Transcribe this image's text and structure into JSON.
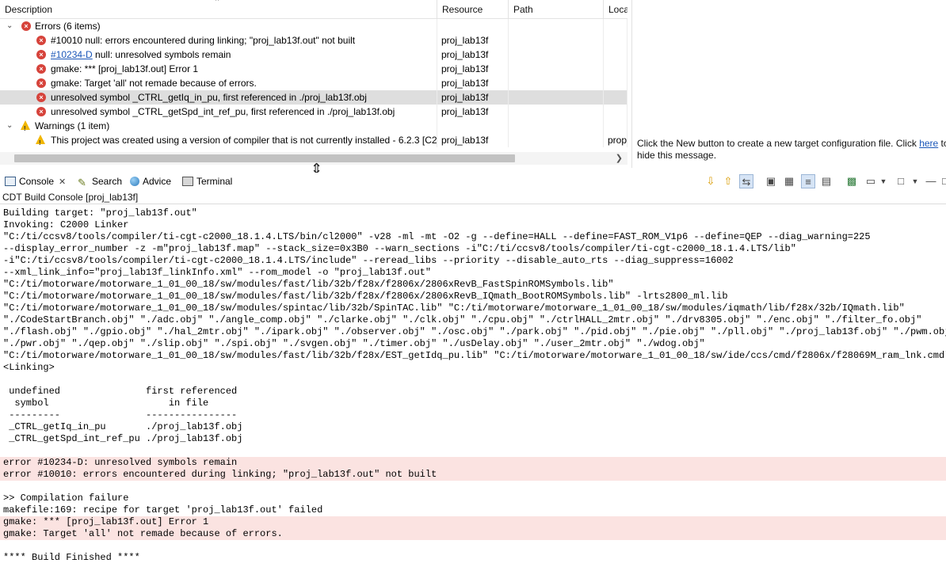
{
  "problems": {
    "columns": {
      "description": "Description",
      "resource": "Resource",
      "path": "Path",
      "location": "Loca"
    },
    "groups": [
      {
        "label": "Errors (6 items)",
        "kind": "error"
      },
      {
        "label": "Warnings (1 item)",
        "kind": "warning"
      }
    ],
    "errors": [
      {
        "link": "",
        "text": "#10010 null: errors encountered during linking; \"proj_lab13f.out\" not built",
        "resource": "proj_lab13f",
        "path": "",
        "location": ""
      },
      {
        "link": "#10234-D",
        "text": " null: unresolved symbols remain",
        "resource": "proj_lab13f",
        "path": "",
        "location": ""
      },
      {
        "link": "",
        "text": "gmake: *** [proj_lab13f.out] Error 1",
        "resource": "proj_lab13f",
        "path": "",
        "location": ""
      },
      {
        "link": "",
        "text": "gmake: Target 'all' not remade because of errors.",
        "resource": "proj_lab13f",
        "path": "",
        "location": ""
      },
      {
        "link": "",
        "text": "unresolved symbol _CTRL_getIq_in_pu, first referenced in ./proj_lab13f.obj",
        "resource": "proj_lab13f",
        "path": "",
        "location": ""
      },
      {
        "link": "",
        "text": "unresolved symbol _CTRL_getSpd_int_ref_pu, first referenced in ./proj_lab13f.obj",
        "resource": "proj_lab13f",
        "path": "",
        "location": ""
      }
    ],
    "warnings": [
      {
        "text": "This project was created using a version of compiler that is not currently installed - 6.2.3 [C20",
        "resource": "proj_lab13f",
        "path": "",
        "location": "prop"
      }
    ]
  },
  "target_panel": {
    "message_pre": "Click the New button to create a new target configuration file. Click ",
    "link": "here",
    "message_post": " to hide this message."
  },
  "view_tabs": {
    "console": "Console",
    "search": "Search",
    "advice": "Advice",
    "terminal": "Terminal"
  },
  "console": {
    "name": "CDT Build Console [proj_lab13f]",
    "lines": [
      {
        "text": "Building target: \"proj_lab13f.out\"",
        "error": false
      },
      {
        "text": "Invoking: C2000 Linker",
        "error": false
      },
      {
        "text": "\"C:/ti/ccsv8/tools/compiler/ti-cgt-c2000_18.1.4.LTS/bin/cl2000\" -v28 -ml -mt -O2 -g --define=HALL --define=FAST_ROM_V1p6 --define=QEP --diag_warning=225",
        "error": false
      },
      {
        "text": "--display_error_number -z -m\"proj_lab13f.map\" --stack_size=0x3B0 --warn_sections -i\"C:/ti/ccsv8/tools/compiler/ti-cgt-c2000_18.1.4.LTS/lib\"",
        "error": false
      },
      {
        "text": "-i\"C:/ti/ccsv8/tools/compiler/ti-cgt-c2000_18.1.4.LTS/include\" --reread_libs --priority --disable_auto_rts --diag_suppress=16002",
        "error": false
      },
      {
        "text": "--xml_link_info=\"proj_lab13f_linkInfo.xml\" --rom_model -o \"proj_lab13f.out\"",
        "error": false
      },
      {
        "text": "\"C:/ti/motorware/motorware_1_01_00_18/sw/modules/fast/lib/32b/f28x/f2806x/2806xRevB_FastSpinROMSymbols.lib\"",
        "error": false
      },
      {
        "text": "\"C:/ti/motorware/motorware_1_01_00_18/sw/modules/fast/lib/32b/f28x/f2806x/2806xRevB_IQmath_BootROMSymbols.lib\" -lrts2800_ml.lib",
        "error": false
      },
      {
        "text": "\"C:/ti/motorware/motorware_1_01_00_18/sw/modules/spintac/lib/32b/SpinTAC.lib\" \"C:/ti/motorware/motorware_1_01_00_18/sw/modules/iqmath/lib/f28x/32b/IQmath.lib\"",
        "error": false
      },
      {
        "text": "\"./CodeStartBranch.obj\" \"./adc.obj\" \"./angle_comp.obj\" \"./clarke.obj\" \"./clk.obj\" \"./cpu.obj\" \"./ctrlHALL_2mtr.obj\" \"./drv8305.obj\" \"./enc.obj\" \"./filter_fo.obj\"",
        "error": false
      },
      {
        "text": "\"./flash.obj\" \"./gpio.obj\" \"./hal_2mtr.obj\" \"./ipark.obj\" \"./observer.obj\" \"./osc.obj\" \"./park.obj\" \"./pid.obj\" \"./pie.obj\" \"./pll.obj\" \"./proj_lab13f.obj\" \"./pwm.obj\"",
        "error": false
      },
      {
        "text": "\"./pwr.obj\" \"./qep.obj\" \"./slip.obj\" \"./spi.obj\" \"./svgen.obj\" \"./timer.obj\" \"./usDelay.obj\" \"./user_2mtr.obj\" \"./wdog.obj\"",
        "error": false
      },
      {
        "text": "\"C:/ti/motorware/motorware_1_01_00_18/sw/modules/fast/lib/32b/f28x/EST_getIdq_pu.lib\" \"C:/ti/motorware/motorware_1_01_00_18/sw/ide/ccs/cmd/f2806x/f28069M_ram_lnk.cmd\"",
        "error": false
      },
      {
        "text": "<Linking>",
        "error": false
      },
      {
        "text": "",
        "error": false
      },
      {
        "text": " undefined               first referenced",
        "error": false
      },
      {
        "text": "  symbol                     in file",
        "error": false
      },
      {
        "text": " ---------               ----------------",
        "error": false
      },
      {
        "text": " _CTRL_getIq_in_pu       ./proj_lab13f.obj",
        "error": false
      },
      {
        "text": " _CTRL_getSpd_int_ref_pu ./proj_lab13f.obj",
        "error": false
      },
      {
        "text": "",
        "error": false
      },
      {
        "text": "error #10234-D: unresolved symbols remain",
        "error": true
      },
      {
        "text": "error #10010: errors encountered during linking; \"proj_lab13f.out\" not built",
        "error": true
      },
      {
        "text": "",
        "error": false
      },
      {
        "text": ">> Compilation failure",
        "error": false
      },
      {
        "text": "makefile:169: recipe for target 'proj_lab13f.out' failed",
        "error": false
      },
      {
        "text": "gmake: *** [proj_lab13f.out] Error 1",
        "error": true
      },
      {
        "text": "gmake: Target 'all' not remade because of errors.",
        "error": true
      },
      {
        "text": "",
        "error": false
      },
      {
        "text": "**** Build Finished ****",
        "error": false
      }
    ]
  },
  "icons": {
    "error": "error-icon",
    "warning": "warning-icon",
    "console": "console-icon",
    "search": "search-icon",
    "advice": "advice-icon",
    "terminal": "terminal-icon"
  },
  "colors": {
    "error_icon": "#d6433b",
    "warning_icon": "#f1b600",
    "error_line_bg": "#fbe3e1",
    "selection": "#dedede",
    "link": "#1a56b8"
  }
}
